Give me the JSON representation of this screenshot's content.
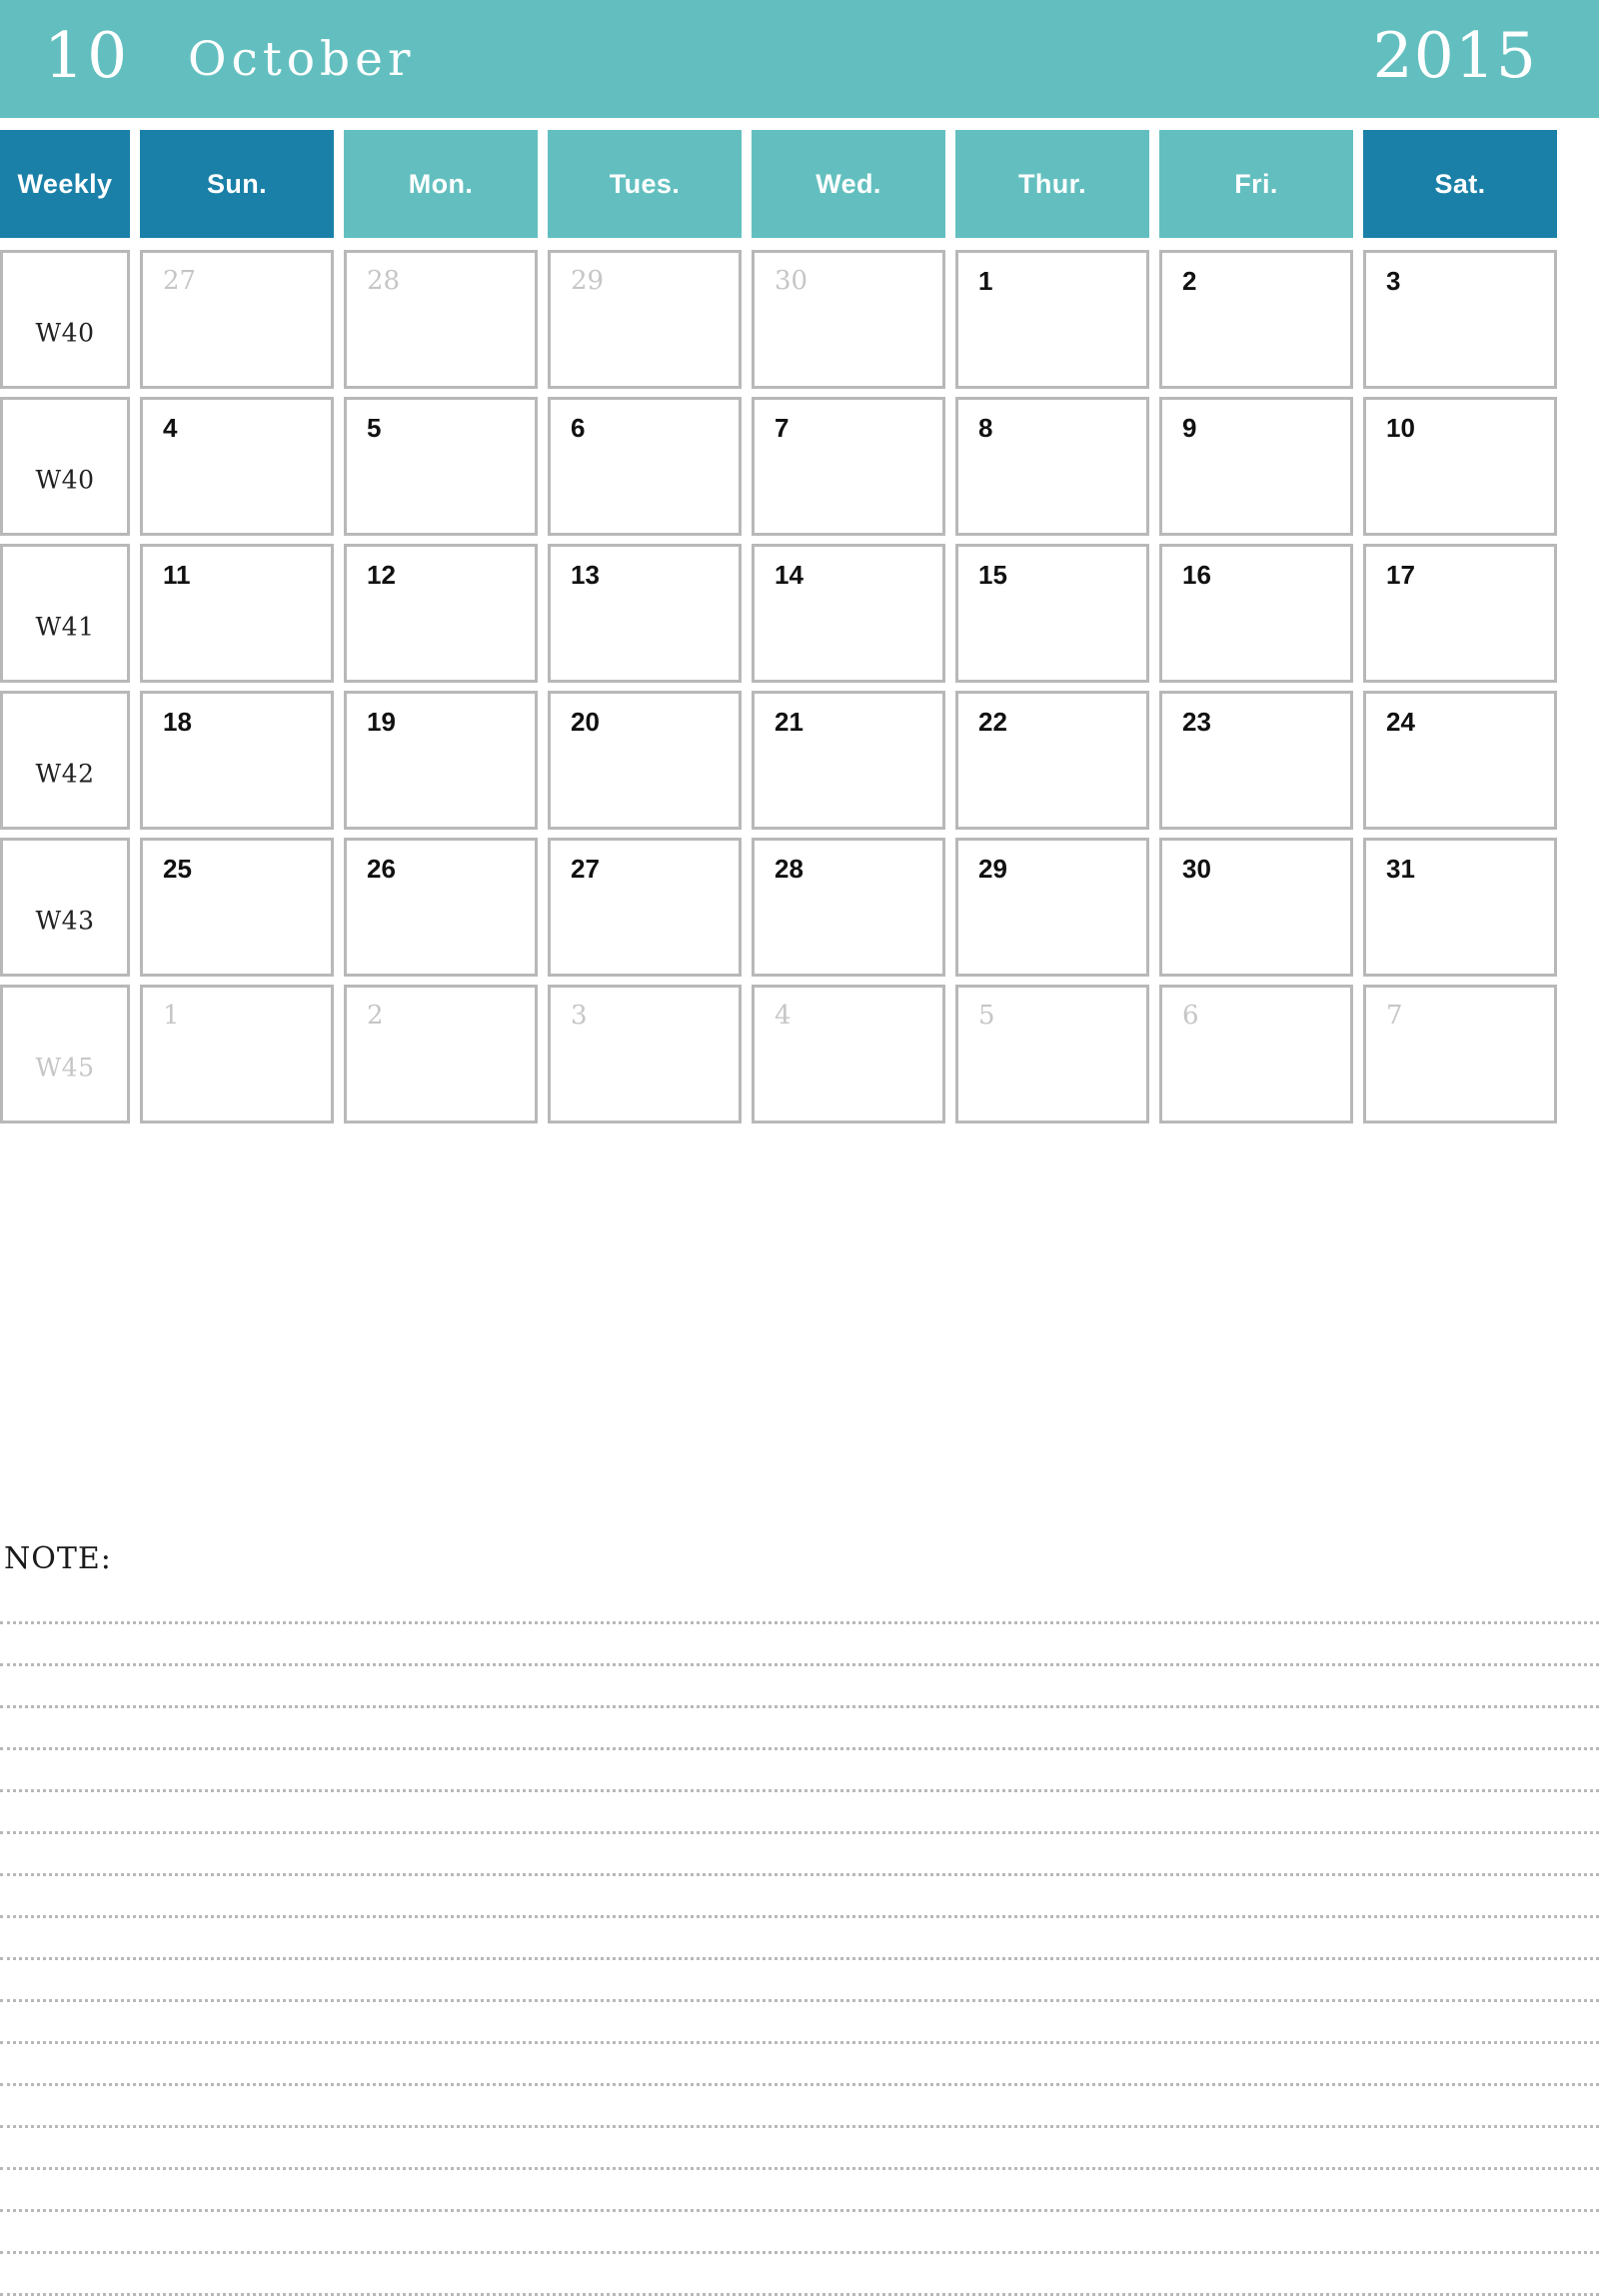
{
  "banner": {
    "month_number": "10",
    "month_name": "October",
    "year": "2015",
    "bg_color": "#63BFBF",
    "text_color": "#FFFFFF"
  },
  "colors": {
    "accent_dark": "#1A80A8",
    "accent_light": "#63BFBF",
    "cell_border": "#B8B8B8",
    "muted_text": "#C6C6C6",
    "active_text": "#111111"
  },
  "header": {
    "weekly_label": "Weekly",
    "days": [
      {
        "label": "Sun.",
        "style": "accent-dark"
      },
      {
        "label": "Mon.",
        "style": "accent-light"
      },
      {
        "label": "Tues.",
        "style": "accent-light"
      },
      {
        "label": "Wed.",
        "style": "accent-light"
      },
      {
        "label": "Thur.",
        "style": "accent-light"
      },
      {
        "label": "Fri.",
        "style": "accent-light"
      },
      {
        "label": "Sat.",
        "style": "accent-dark"
      }
    ]
  },
  "weeks": [
    {
      "week_label": "W40",
      "week_muted": false,
      "days": [
        {
          "n": "27",
          "muted": true
        },
        {
          "n": "28",
          "muted": true
        },
        {
          "n": "29",
          "muted": true
        },
        {
          "n": "30",
          "muted": true
        },
        {
          "n": "1",
          "muted": false
        },
        {
          "n": "2",
          "muted": false
        },
        {
          "n": "3",
          "muted": false
        }
      ]
    },
    {
      "week_label": "W40",
      "week_muted": false,
      "days": [
        {
          "n": "4",
          "muted": false
        },
        {
          "n": "5",
          "muted": false
        },
        {
          "n": "6",
          "muted": false
        },
        {
          "n": "7",
          "muted": false
        },
        {
          "n": "8",
          "muted": false
        },
        {
          "n": "9",
          "muted": false
        },
        {
          "n": "10",
          "muted": false
        }
      ]
    },
    {
      "week_label": "W41",
      "week_muted": false,
      "days": [
        {
          "n": "11",
          "muted": false
        },
        {
          "n": "12",
          "muted": false
        },
        {
          "n": "13",
          "muted": false
        },
        {
          "n": "14",
          "muted": false
        },
        {
          "n": "15",
          "muted": false
        },
        {
          "n": "16",
          "muted": false
        },
        {
          "n": "17",
          "muted": false
        }
      ]
    },
    {
      "week_label": "W42",
      "week_muted": false,
      "days": [
        {
          "n": "18",
          "muted": false
        },
        {
          "n": "19",
          "muted": false
        },
        {
          "n": "20",
          "muted": false
        },
        {
          "n": "21",
          "muted": false
        },
        {
          "n": "22",
          "muted": false
        },
        {
          "n": "23",
          "muted": false
        },
        {
          "n": "24",
          "muted": false
        }
      ]
    },
    {
      "week_label": "W43",
      "week_muted": false,
      "days": [
        {
          "n": "25",
          "muted": false
        },
        {
          "n": "26",
          "muted": false
        },
        {
          "n": "27",
          "muted": false
        },
        {
          "n": "28",
          "muted": false
        },
        {
          "n": "29",
          "muted": false
        },
        {
          "n": "30",
          "muted": false
        },
        {
          "n": "31",
          "muted": false
        }
      ]
    },
    {
      "week_label": "W45",
      "week_muted": true,
      "days": [
        {
          "n": "1",
          "muted": true
        },
        {
          "n": "2",
          "muted": true
        },
        {
          "n": "3",
          "muted": true
        },
        {
          "n": "4",
          "muted": true
        },
        {
          "n": "5",
          "muted": true
        },
        {
          "n": "6",
          "muted": true
        },
        {
          "n": "7",
          "muted": true
        }
      ]
    }
  ],
  "note": {
    "label": "NOTE:",
    "line_count": 17
  }
}
